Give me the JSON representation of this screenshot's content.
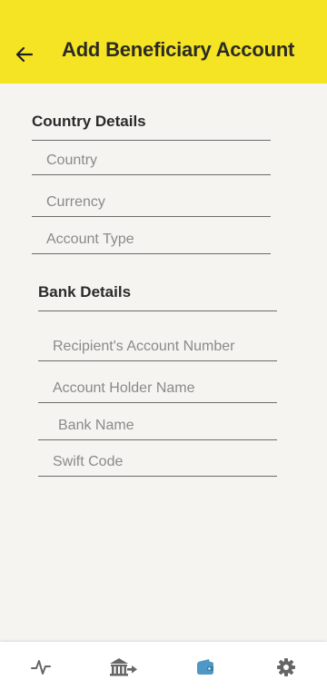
{
  "header": {
    "title": "Add Beneficiary Account",
    "back_icon": "arrow-left-icon",
    "background_color": "#f5e424"
  },
  "country_details": {
    "title": "Country Details",
    "fields": [
      {
        "placeholder": "Country"
      },
      {
        "placeholder": "Currency"
      },
      {
        "placeholder": "Account Type"
      }
    ]
  },
  "bank_details": {
    "title": "Bank Details",
    "fields": [
      {
        "placeholder": "Recipient's Account Number"
      },
      {
        "placeholder": "Account Holder Name"
      },
      {
        "placeholder": "Bank Name"
      },
      {
        "placeholder": "Swift Code"
      }
    ]
  },
  "bottom_nav": {
    "items": [
      {
        "icon": "activity-icon"
      },
      {
        "icon": "bank-transfer-icon"
      },
      {
        "icon": "wallet-icon",
        "active": true
      },
      {
        "icon": "gear-icon"
      }
    ],
    "active_color": "#4f97c4",
    "inactive_color": "#666666"
  }
}
